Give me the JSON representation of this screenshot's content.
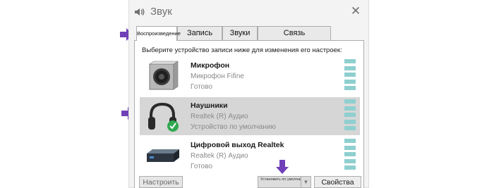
{
  "window": {
    "title": "Звук",
    "close_glyph": "✕"
  },
  "tabs": [
    {
      "label": "Воспроизведение",
      "active": true
    },
    {
      "label": "Запись",
      "active": false
    },
    {
      "label": "Звуки",
      "active": false
    },
    {
      "label": "Связь",
      "active": false
    }
  ],
  "instruction": "Выберите устройство записи ниже для изменения его настроек:",
  "devices": [
    {
      "name": "Микрофон",
      "subtitle": "Микрофон Fifine",
      "status": "Готово",
      "icon": "microphone-device-icon",
      "selected": false
    },
    {
      "name": "Наушники",
      "subtitle": "Realtek (R) Аудио",
      "status": "Устройство по умолчанию",
      "icon": "headphones-icon",
      "selected": true
    },
    {
      "name": "Цифровой выход Realtek",
      "subtitle": "Realtek (R) Аудио",
      "status": "Готово",
      "icon": "digital-output-icon",
      "selected": false
    }
  ],
  "buttons": {
    "configure": "Настроить",
    "set_default": "Установить по умолчанию",
    "properties": "Свойства"
  },
  "colors": {
    "annotation_arrow": "#7040b8",
    "level_meter": "#8fcfcf",
    "selection": "#d6d6d6",
    "default_badge": "#2fa84f"
  }
}
